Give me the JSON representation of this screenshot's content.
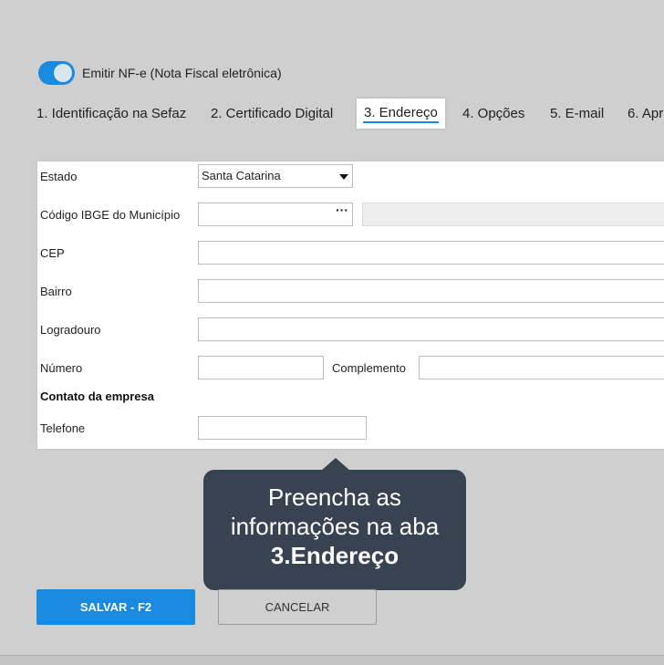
{
  "header": {
    "toggle_label": "Emitir NF-e (Nota Fiscal eletrônica)",
    "toggle_on": true
  },
  "tabs": [
    {
      "label": "1. Identificação na Sefaz"
    },
    {
      "label": "2. Certificado Digital"
    },
    {
      "label": "3. Endereço",
      "active": true
    },
    {
      "label": "4. Opções"
    },
    {
      "label": "5. E-mail"
    },
    {
      "label": "6. Apr"
    }
  ],
  "form": {
    "estado_label": "Estado",
    "estado_value": "Santa Catarina",
    "ibge_label": "Código IBGE do Município",
    "ibge_value": "",
    "ibge_button": "···",
    "cep_label": "CEP",
    "cep_value": "",
    "bairro_label": "Bairro",
    "bairro_value": "",
    "logradouro_label": "Logradouro",
    "logradouro_value": "",
    "numero_label": "Número",
    "numero_value": "",
    "complemento_label": "Complemento",
    "complemento_value": "",
    "contato_title": "Contato da empresa",
    "telefone_label": "Telefone",
    "telefone_value": ""
  },
  "tooltip": {
    "line1": "Preencha as",
    "line2": "informações na aba",
    "line3": "3.Endereço"
  },
  "footer": {
    "save_label": "SALVAR - F2",
    "cancel_label": "CANCELAR"
  },
  "colors": {
    "accent": "#1a8ae0",
    "tooltip_bg": "#374350",
    "page_bg": "#cfcfcf"
  }
}
